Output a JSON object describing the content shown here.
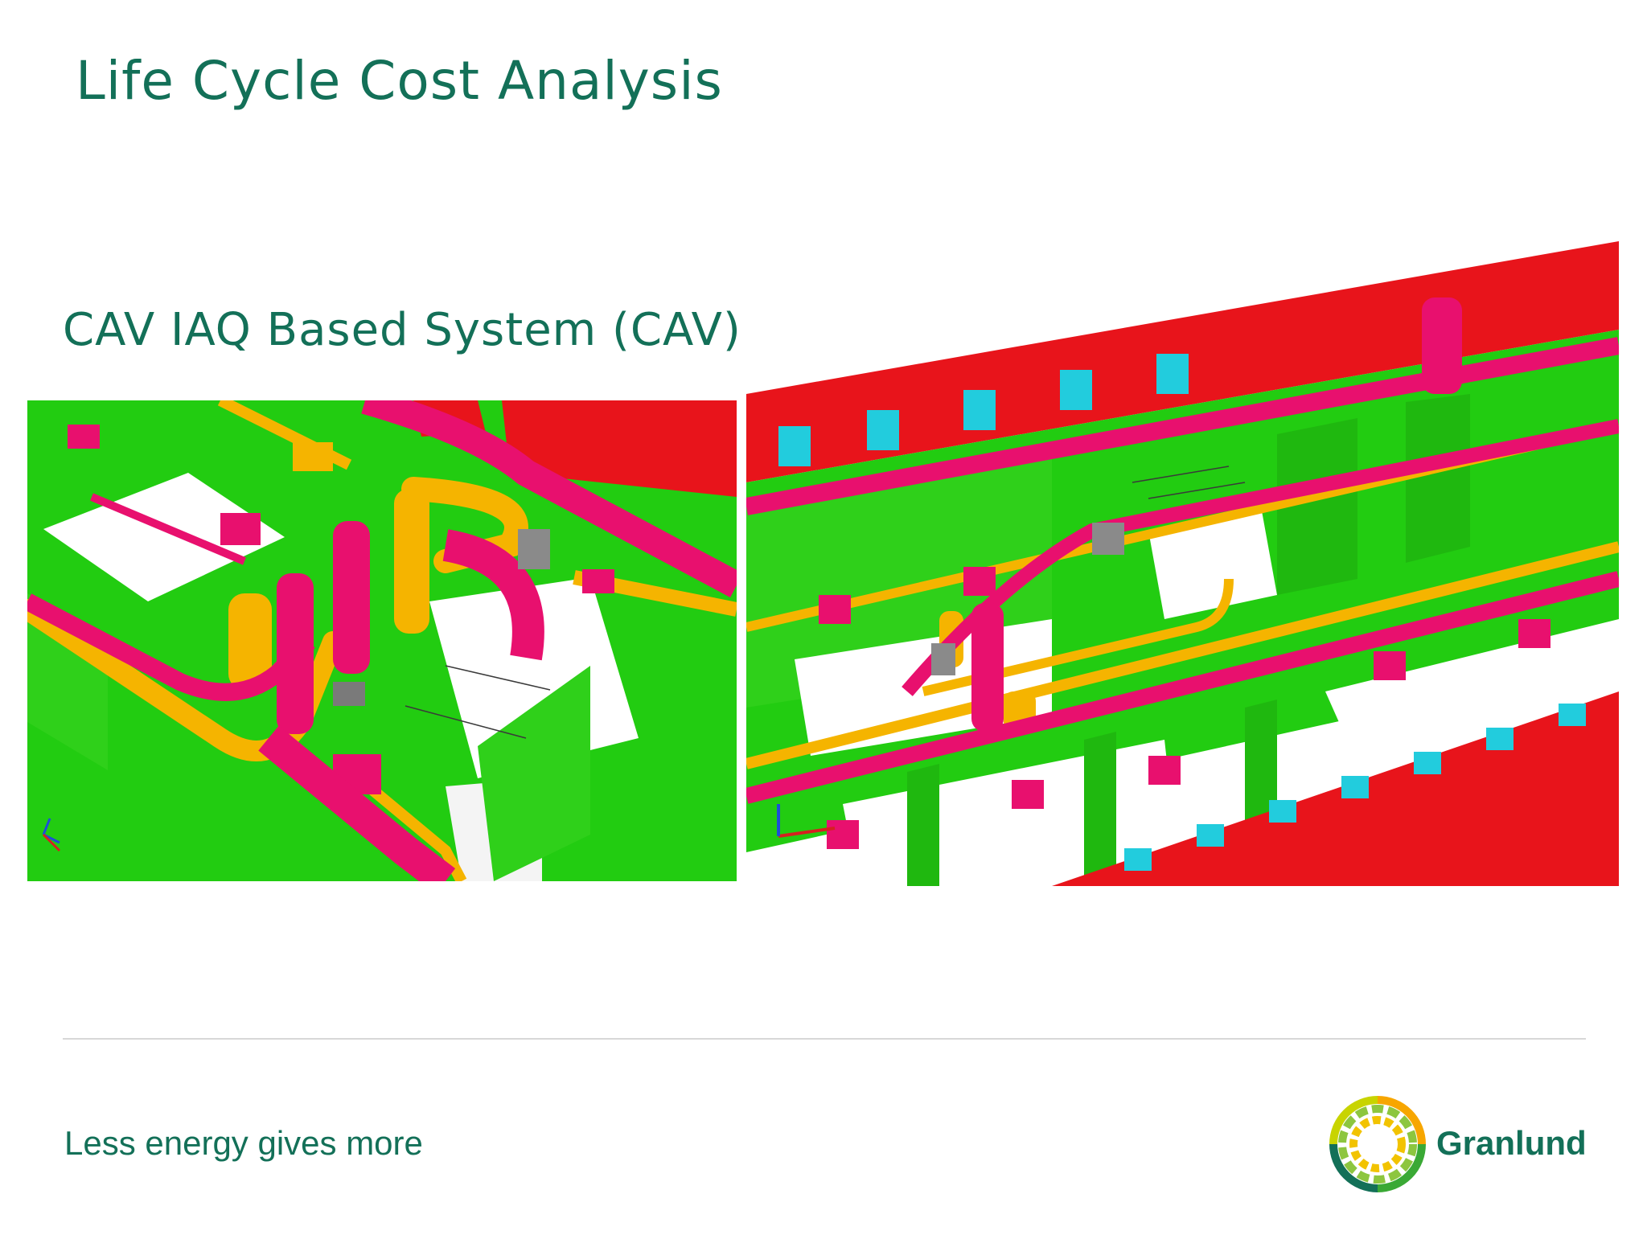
{
  "slide": {
    "title": "Life Cycle Cost Analysis",
    "subtitle": "CAV IAQ Based System (CAV)"
  },
  "images": [
    {
      "name": "left",
      "description_icon": "3d-hvac-model-closeup"
    },
    {
      "name": "right",
      "description_icon": "3d-hvac-model-overview"
    }
  ],
  "footer": {
    "tagline": "Less energy gives more",
    "brand": "Granlund"
  },
  "colors": {
    "brand_green": "#137058",
    "model_green": "#22cc11",
    "duct_magenta": "#e8106e",
    "pipe_yellow": "#f5b400",
    "wall_red": "#e8141b",
    "window_cyan": "#22ccdd"
  }
}
